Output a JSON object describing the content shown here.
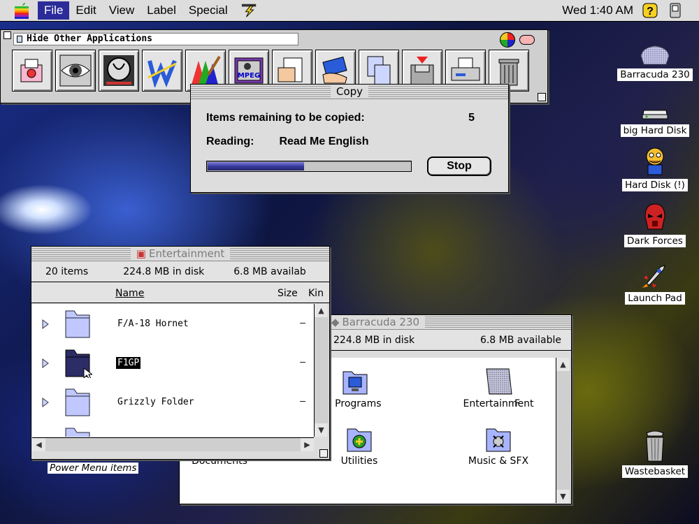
{
  "menubar": {
    "menus": [
      "File",
      "Edit",
      "View",
      "Label",
      "Special"
    ],
    "active_menu": "File",
    "clock": "Wed 1:40 AM"
  },
  "launcher": {
    "hide_label": "Hide Other Applications",
    "tiles": [
      "app-1-icon",
      "eye-icon",
      "clock-face-icon",
      "w-letter-icon",
      "paint-brush-icon",
      "mpeg-icon",
      "document-hand-icon",
      "hand-card-icon",
      "documents-icon",
      "floppy-icon",
      "printer-icon",
      "trash-icon"
    ],
    "mpeg_text": "MPEG"
  },
  "copy_dialog": {
    "title": "Copy",
    "remaining_label": "Items remaining to be copied:",
    "remaining_count": "5",
    "reading_label": "Reading:",
    "reading_file": "Read Me English",
    "progress": 0.48,
    "stop_label": "Stop"
  },
  "barracuda_window": {
    "title": "Barracuda 230",
    "disk_used": "224.8 MB in disk",
    "available": "6.8 MB available",
    "items": [
      {
        "label": "pation Programs",
        "icon": "applications-folder-icon"
      },
      {
        "label": "Entertainment",
        "icon": "entertainment-folder-icon"
      },
      {
        "label": "F",
        "icon": "folder-icon"
      },
      {
        "label": "Documents",
        "icon": "folder-icon"
      },
      {
        "label": "Utilities",
        "icon": "utilities-folder-icon"
      },
      {
        "label": "Music & SFX",
        "icon": "music-folder-icon"
      }
    ]
  },
  "entertainment_window": {
    "title": "Entertainment",
    "item_count": "20 items",
    "disk_used": "224.8 MB in disk",
    "available": "6.8 MB availab",
    "col_name": "Name",
    "col_size": "Size",
    "col_kind": "Kin",
    "rows": [
      {
        "name": "F/A-18 Hornet",
        "size": "–",
        "selected": false
      },
      {
        "name": "F1GP",
        "size": "–",
        "selected": true
      },
      {
        "name": "Grizzly Folder",
        "size": "–",
        "selected": false
      }
    ]
  },
  "desktop": {
    "icons": [
      {
        "label": "Barracuda 230",
        "icon": "disk-icon"
      },
      {
        "label": "big Hard Disk",
        "icon": "hard-disk-icon"
      },
      {
        "label": "Hard Disk (!)",
        "icon": "cartoon-character-icon"
      },
      {
        "label": "Dark Forces",
        "icon": "stormtrooper-icon"
      },
      {
        "label": "Launch Pad",
        "icon": "rocket-icon"
      },
      {
        "label": "Wastebasket",
        "icon": "trash-can-icon"
      }
    ],
    "power_menu_label": "Power Menu items"
  },
  "colors": {
    "menu_highlight": "#2b2b9a",
    "progress_fill": "#3a3aa0",
    "window_bg": "#dcdcdc"
  }
}
